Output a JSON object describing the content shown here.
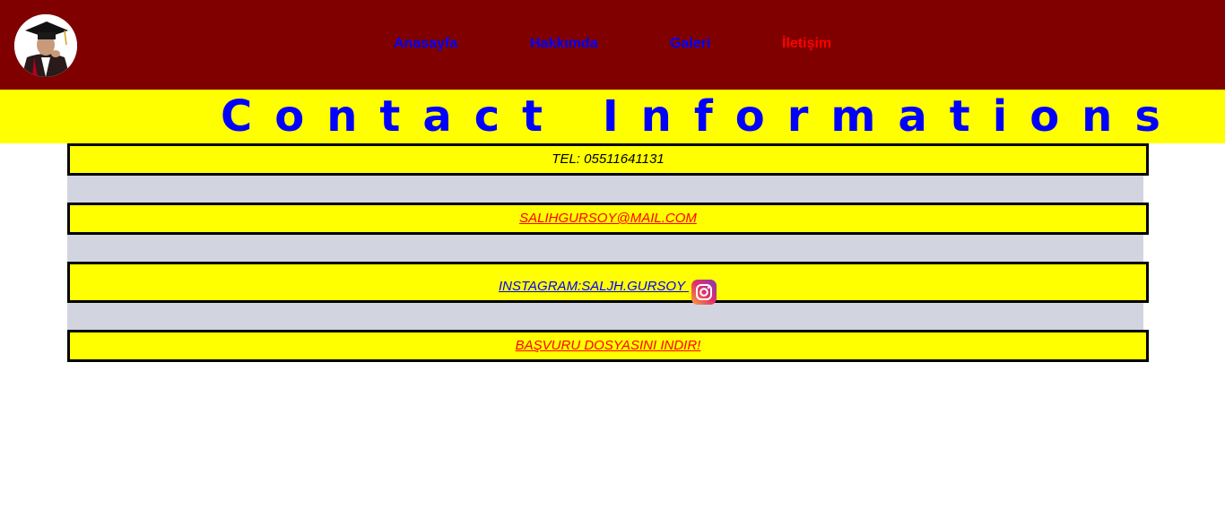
{
  "header": {
    "avatar_icon": "graduate-avatar-icon",
    "background": "#800000",
    "nav": [
      {
        "label": "Anasayfa",
        "active": false
      },
      {
        "label": "Hakkımda",
        "active": false
      },
      {
        "label": "Galeri",
        "active": false
      },
      {
        "label": "İletişim",
        "active": true
      }
    ]
  },
  "banner": {
    "title": "Contact Informations",
    "background": "#ffff00",
    "color": "#0000ff"
  },
  "contact": {
    "phone": "TEL: 05511641131",
    "email": "SALIHGURSOY@MAIL.COM",
    "instagram": "INSTAGRAM:SALJH.GURSOY",
    "instagram_icon": "instagram-icon",
    "download": "BAŞVURU DOSYASINI INDIR!"
  },
  "colors": {
    "link_red": "#ff0000",
    "link_blue": "#0000ff",
    "panel_gray": "#d2d5e0"
  }
}
